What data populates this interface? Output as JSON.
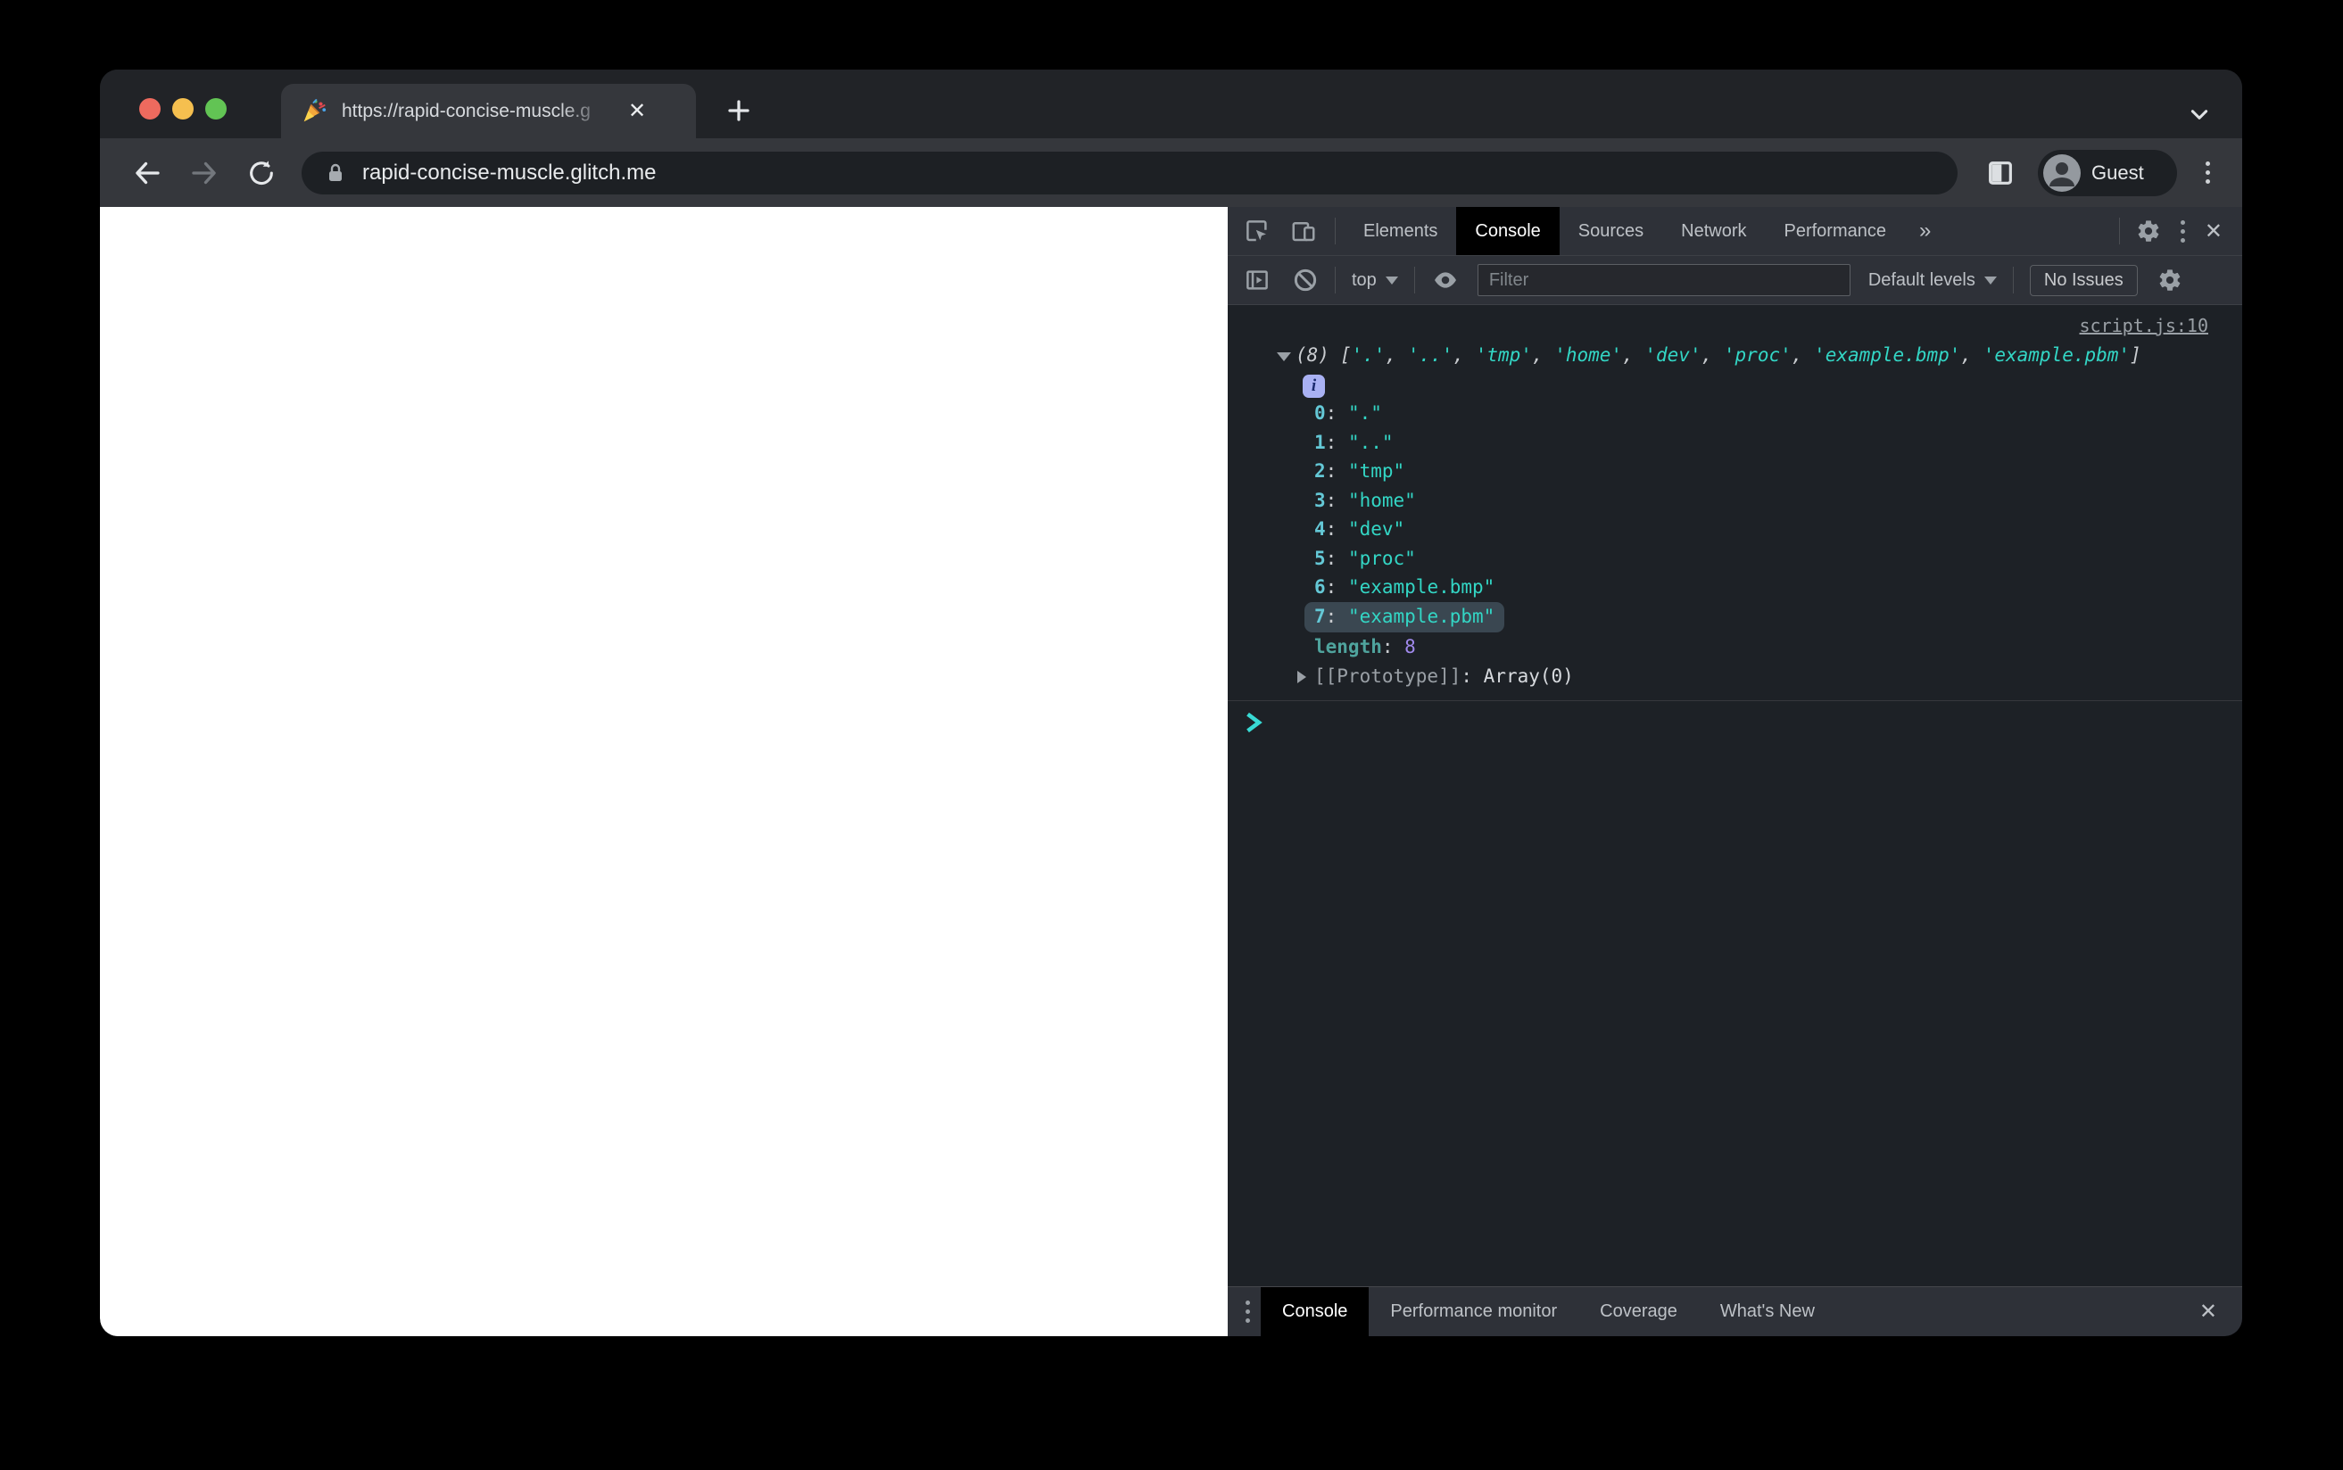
{
  "colors": {
    "accent_teal": "#33d6c5",
    "index_teal": "#64c8d6",
    "number_purple": "#a089ec",
    "muted_gray": "#9aa0a6",
    "panel_bar": "#2e3138",
    "console_bg": "#1d2126",
    "chrome_toolbar": "#35373c",
    "highlight_row": "#3a4751",
    "traffic_red": "#ee6a5e",
    "traffic_yellow": "#f5bf4f",
    "traffic_green": "#62c454"
  },
  "browser": {
    "tab": {
      "title": "https://rapid-concise-muscle.g",
      "favicon": "party-popper"
    },
    "tab_close_glyph": "✕",
    "url": "rapid-concise-muscle.glitch.me",
    "profile_label": "Guest"
  },
  "devtools": {
    "tabs": [
      "Elements",
      "Console",
      "Sources",
      "Network",
      "Performance"
    ],
    "overflow_glyph": "»",
    "close_glyph": "✕",
    "toolbar": {
      "context_label": "top",
      "filter_placeholder": "Filter",
      "levels_label": "Default levels",
      "issues_label": "No Issues"
    },
    "console": {
      "source_link": "script.js:10",
      "count_label": "(8)",
      "bracket_open": "[",
      "bracket_close": "]",
      "separator": ", ",
      "colon": ": ",
      "info_glyph": "i",
      "preview_items": [
        "'.'",
        "'..'",
        "'tmp'",
        "'home'",
        "'dev'",
        "'proc'",
        "'example.bmp'",
        "'example.pbm'"
      ],
      "entries": [
        {
          "index": "0",
          "value": "\".\""
        },
        {
          "index": "1",
          "value": "\"..\""
        },
        {
          "index": "2",
          "value": "\"tmp\""
        },
        {
          "index": "3",
          "value": "\"home\""
        },
        {
          "index": "4",
          "value": "\"dev\""
        },
        {
          "index": "5",
          "value": "\"proc\""
        },
        {
          "index": "6",
          "value": "\"example.bmp\""
        },
        {
          "index": "7",
          "value": "\"example.pbm\""
        }
      ],
      "length_label": "length",
      "length_value": "8",
      "prototype_label": "[[Prototype]]",
      "prototype_value": "Array(0)"
    },
    "drawer_tabs": [
      "Console",
      "Performance monitor",
      "Coverage",
      "What's New"
    ]
  }
}
